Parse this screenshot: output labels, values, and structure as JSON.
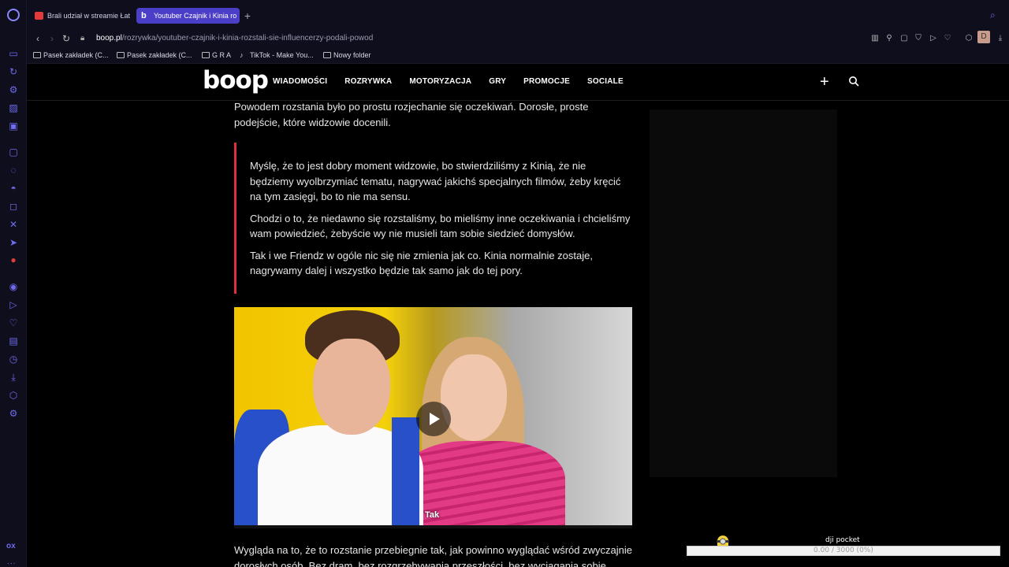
{
  "browser": {
    "tabs": [
      {
        "label": "Brali udział w streamie Łat",
        "favicon": "youtube-icon"
      },
      {
        "label": "Youtuber Czajnik i Kinia ro",
        "favicon": "boop-icon",
        "active": true
      }
    ],
    "url_domain": "boop.pl",
    "url_path": "/rozrywka/youtuber-czajnik-i-kinia-rozstali-sie-influencerzy-podali-powod",
    "profile_initial": "D",
    "bookmarks": [
      "Pasek zakładek (C...",
      "Pasek zakładek (C...",
      "G R A",
      "TikTok - Make You...",
      "Nowy folder"
    ],
    "sidebar_bottom": "ox",
    "sidebar_more": "..."
  },
  "site": {
    "logo": "boop",
    "menu": [
      "WIADOMOŚCI",
      "ROZRYWKA",
      "MOTORYZACJA",
      "GRY",
      "PROMOCJE",
      "SOCIALE"
    ]
  },
  "article": {
    "intro": "Powodem rozstania było po prostu rozjechanie się oczekiwań. Dorosłe, proste podejście, które widzowie docenili.",
    "quote": [
      "Myślę, że to jest dobry moment widzowie, bo stwierdziliśmy z Kinią, że nie będziemy wyolbrzymiać tematu, nagrywać jakichś specjalnych filmów, żeby kręcić na tym zasięgi, bo to nie ma sensu.",
      "Chodzi o to, że niedawno się rozstaliśmy, bo mieliśmy inne oczekiwania i chcieliśmy wam powiedzieć, żebyście wy nie musieli tam sobie siedzieć domysłów.",
      "Tak i we Friendz w ogóle nic się nie zmienia jak co. Kinia normalnie zostaje, nagrywamy dalej i wszystko będzie tak samo jak do tej pory."
    ],
    "video_caption": "Tak",
    "outro": "Wygląda na to, że to rozstanie przebiegnie tak, jak powinno wyglądać wśród zwyczajnie dorosłych osób. Bez dram, bez rozgrzebywania przeszłości, bez wyciągania sobie brudów"
  },
  "widget": {
    "title": "dji pocket",
    "progress_text": "0.00 / 3000 (0%)",
    "progress": 0
  },
  "colors": {
    "accent": "#4b3fc8",
    "quote_border": "#e0303e",
    "sidebar_icon": "#6f6cf0"
  }
}
